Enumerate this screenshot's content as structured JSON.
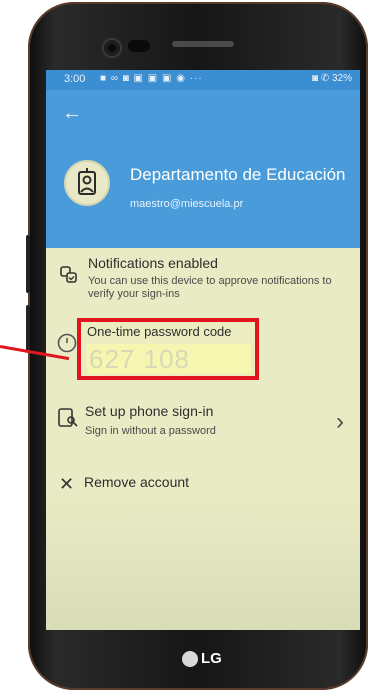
{
  "status_bar": {
    "time": "3:00",
    "icons": "■ ∞ ◙ ▣ ▣ ▣ ◉ ···",
    "right": "◙ ✆ 32%"
  },
  "header": {
    "org_name": "Departamento de Educación",
    "email": "maestro@miescuela.pr"
  },
  "notifications": {
    "title": "Notifications enabled",
    "subtitle": "You can use this device to approve notifications to verify your sign-ins"
  },
  "otp": {
    "label": "One-time password code",
    "code": "627 108"
  },
  "phone_signin": {
    "title": "Set up phone sign-in",
    "subtitle": "Sign in without a password"
  },
  "remove_account": {
    "label": "Remove account"
  },
  "brand": "LG",
  "colors": {
    "header_bg": "#4a9bd9",
    "screen_bg": "#e9ebc4",
    "highlight": "#e1151f"
  }
}
